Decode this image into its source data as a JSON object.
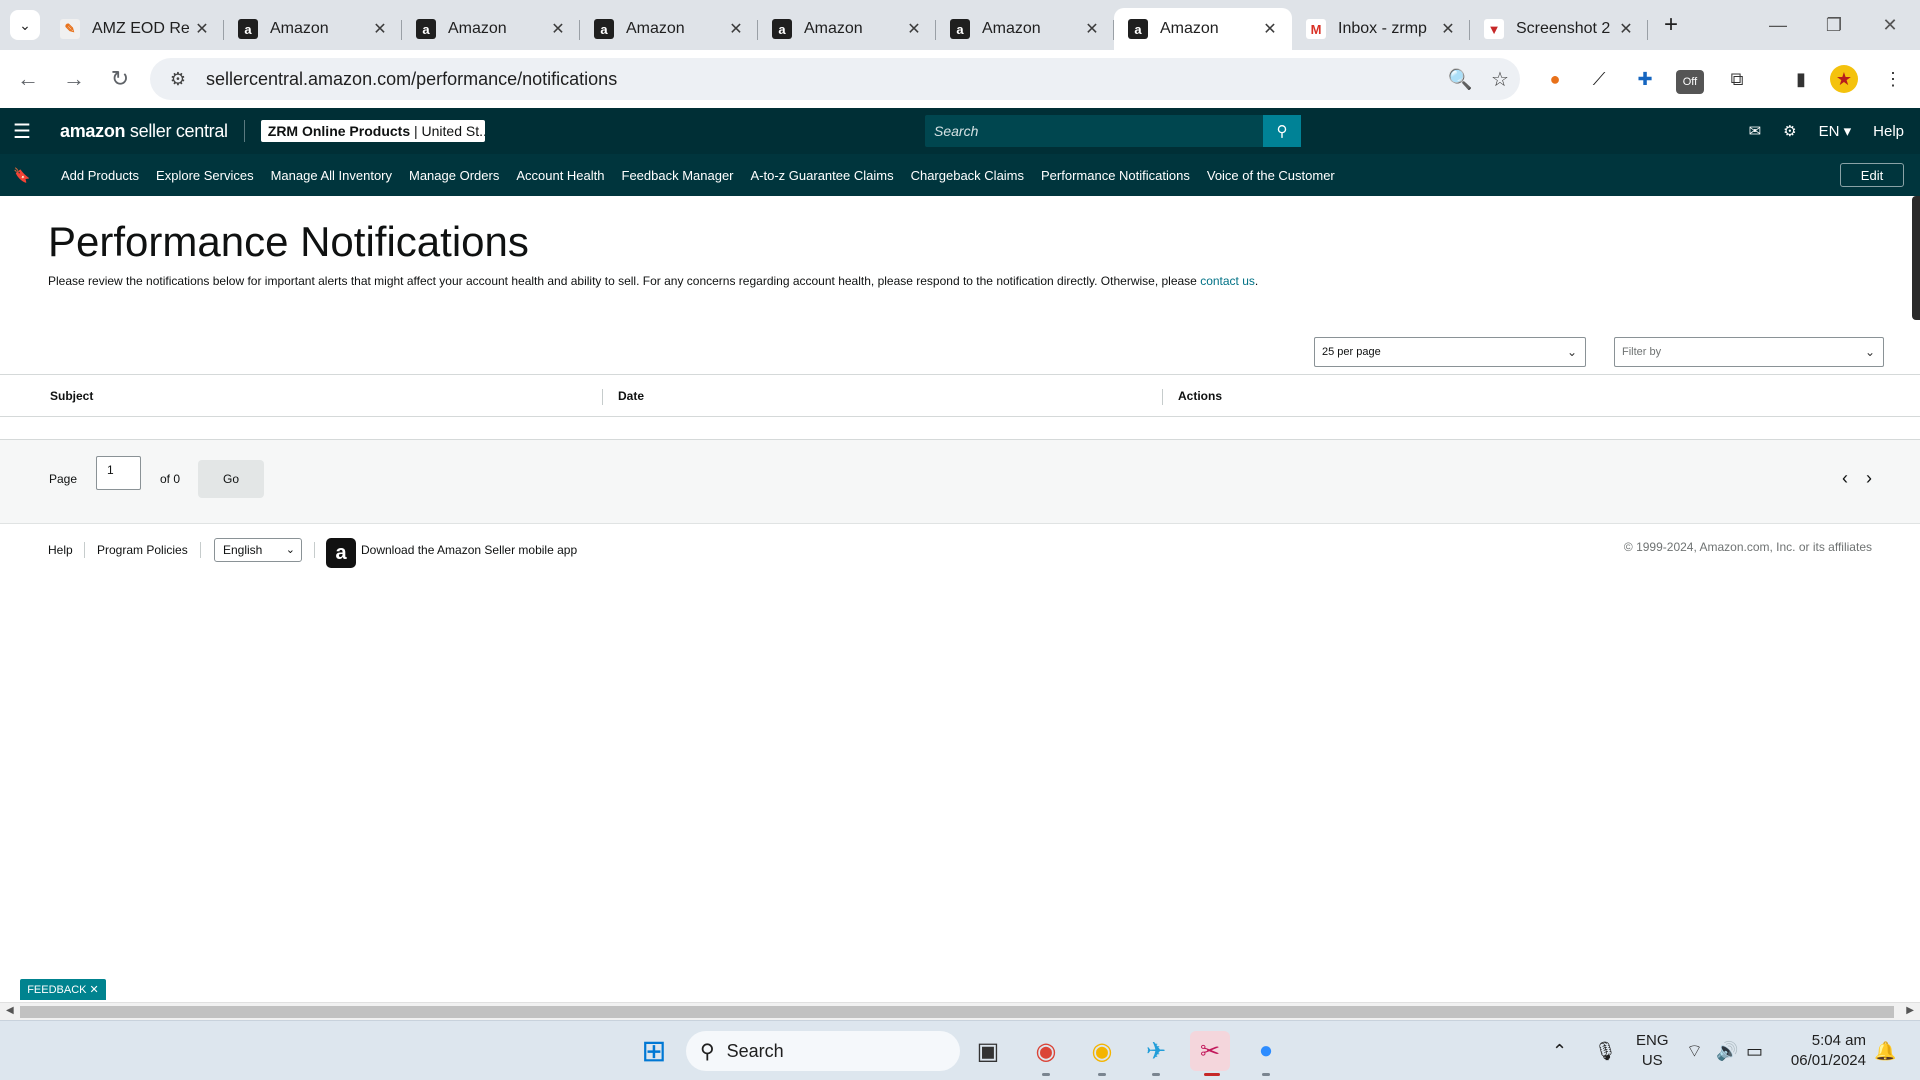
{
  "browser": {
    "tabs": [
      {
        "title": "AMZ EOD Re",
        "favicon": "eod-icon",
        "active": false
      },
      {
        "title": "Amazon",
        "favicon": "amazon-icon",
        "active": false
      },
      {
        "title": "Amazon",
        "favicon": "amazon-icon",
        "active": false
      },
      {
        "title": "Amazon",
        "favicon": "amazon-icon",
        "active": false
      },
      {
        "title": "Amazon",
        "favicon": "amazon-icon",
        "active": false
      },
      {
        "title": "Amazon",
        "favicon": "amazon-icon",
        "active": false
      },
      {
        "title": "Amazon",
        "favicon": "amazon-icon",
        "active": true
      },
      {
        "title": "Inbox - zrmp",
        "favicon": "gmail-icon",
        "active": false
      },
      {
        "title": "Screenshot 2",
        "favicon": "screenshot-icon",
        "active": false
      }
    ],
    "url": "sellercentral.amazon.com/performance/notifications",
    "extension_badge": "Off"
  },
  "header": {
    "logo_main": "amazon",
    "logo_sub": " seller central",
    "account_bold": "ZRM Online Products",
    "account_rest": " | United St...",
    "search_placeholder": "Search",
    "language": "EN ▾",
    "help": "Help"
  },
  "nav": {
    "items": [
      "Add Products",
      "Explore Services",
      "Manage All Inventory",
      "Manage Orders",
      "Account Health",
      "Feedback Manager",
      "A-to-z Guarantee Claims",
      "Chargeback Claims",
      "Performance Notifications",
      "Voice of the Customer"
    ],
    "edit_label": "Edit"
  },
  "page": {
    "title": "Performance Notifications",
    "description": "Please review the notifications below for important alerts that might affect your account health and ability to sell. For any concerns regarding account health, please respond to the notification directly. Otherwise, please ",
    "contact_link": "contact us",
    "per_page": "25 per page",
    "filter_placeholder": "Filter by"
  },
  "table": {
    "columns": [
      "Subject",
      "Date",
      "Actions"
    ],
    "rows": []
  },
  "pagination": {
    "page_label": "Page",
    "current_page": "1",
    "of_label": "of 0",
    "go_label": "Go"
  },
  "footer": {
    "help": "Help",
    "program_policies": "Program Policies",
    "language": "English",
    "app_link": "Download the Amazon Seller mobile app",
    "copyright": "© 1999-2024, Amazon.com, Inc. or its affiliates"
  },
  "feedback_label": "FEEDBACK ✕",
  "taskbar": {
    "search_label": "Search",
    "lang_line1": "ENG",
    "lang_line2": "US",
    "time": "5:04 am",
    "date": "06/01/2024"
  },
  "colors": {
    "header_bg": "#002f36",
    "nav_bg": "#00353d",
    "search_button": "#008296",
    "link": "#007185",
    "feedback": "#00838f"
  }
}
